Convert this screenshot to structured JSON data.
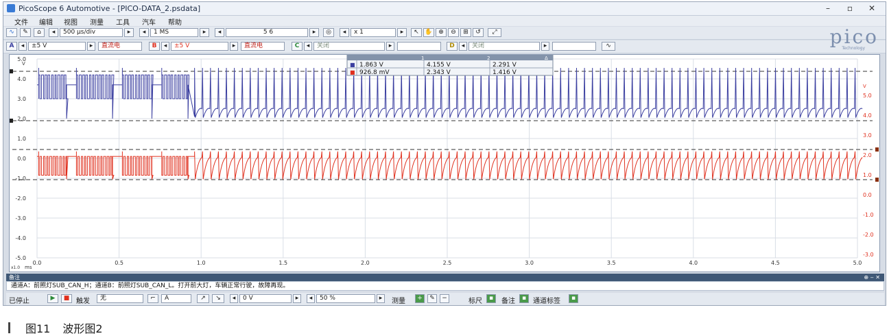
{
  "window": {
    "title": "PicoScope 6 Automotive - [PICO-DATA_2.psdata]",
    "minimize": "–",
    "maximize": "▫",
    "close": "✕"
  },
  "menu": [
    "文件",
    "编辑",
    "视图",
    "测量",
    "工具",
    "汽车",
    "帮助"
  ],
  "toolbar1": {
    "timebase": "500 µs/div",
    "samples": "1 MS",
    "buffer": "5 6",
    "zoom": "x 1"
  },
  "toolbar2": {
    "chA_label": "A",
    "chA_range": "±5 V",
    "chA_coupling": "直流电",
    "chB_label": "B",
    "chB_range": "±5 V",
    "chB_coupling": "直流电",
    "chC_label": "C",
    "chC_state": "关闭",
    "chD_label": "D",
    "chD_state": "关闭"
  },
  "brand": {
    "logo": "pico",
    "sub": "Technology"
  },
  "rulers": {
    "header": [
      "",
      "1",
      "2",
      "Δ"
    ],
    "rows": [
      [
        "■",
        "1.863 V",
        "4.155 V",
        "2.291 V"
      ],
      [
        "■",
        "926.8 mV",
        "2.343 V",
        "1.416 V"
      ]
    ]
  },
  "axes": {
    "left_ticks": [
      "5.0",
      "4.0",
      "3.0",
      "2.0",
      "1.0",
      "0.0",
      "-1.0",
      "-2.0",
      "-3.0",
      "-4.0",
      "-5.0"
    ],
    "left_unit": "V",
    "right_ticks": [
      "5.0",
      "4.0",
      "3.0",
      "2.0",
      "1.0",
      "0.0",
      "-1.0",
      "-2.0",
      "-3.0"
    ],
    "right_unit": "V",
    "x_ticks": [
      "0.0",
      "0.5",
      "1.0",
      "1.5",
      "2.0",
      "2.5",
      "3.0",
      "3.5",
      "4.0",
      "4.5",
      "5.0"
    ],
    "x_unit": "ms",
    "x_scale": "x1.0"
  },
  "notes": {
    "title": "备注",
    "text": "通道A：前照灯SUB_CAN_H；通道B：前照灯SUB_CAN_L。打开前大灯，车辆正常行驶，故障再现。"
  },
  "statusbar": {
    "stopped": "已停止",
    "trigger_label": "触发",
    "trigger_value": "无",
    "trigger_channel": "A",
    "level": "0 V",
    "pretrigger": "50 %",
    "measure": "测量",
    "ruler": "标尺",
    "notes": "备注",
    "channel_labels": "通道标签"
  },
  "caption": {
    "figure": "图11",
    "title": "波形图2"
  },
  "colors": {
    "channelA": "#3b3fa0",
    "channelB": "#e0301e",
    "titlebar": "#eef2f8",
    "notebar": "#3f5876"
  }
}
